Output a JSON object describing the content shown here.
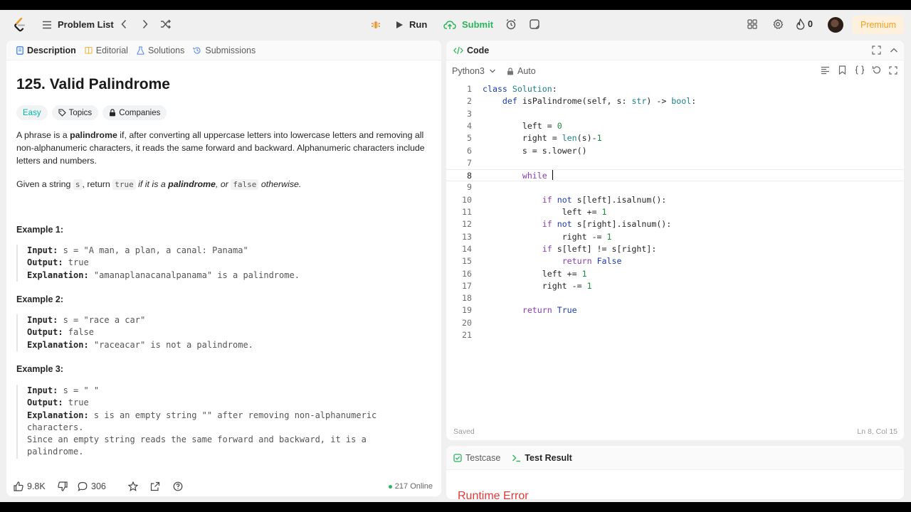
{
  "nav": {
    "problem_list": "Problem List",
    "run": "Run",
    "submit": "Submit",
    "streak": "0",
    "premium": "Premium"
  },
  "left": {
    "tabs": [
      {
        "label": "Description"
      },
      {
        "label": "Editorial"
      },
      {
        "label": "Solutions"
      },
      {
        "label": "Submissions"
      }
    ],
    "title": "125. Valid Palindrome",
    "badges": {
      "difficulty": "Easy",
      "topics": "Topics",
      "companies": "Companies"
    },
    "desc1": {
      "a": "A phrase is a ",
      "b": "palindrome",
      "c": " if, after converting all uppercase letters into lowercase letters and removing all non-alphanumeric characters, it reads the same forward and backward. Alphanumeric characters include letters and numbers."
    },
    "desc2": {
      "a": "Given a string ",
      "s": "s",
      "b": ", return ",
      "t": "true",
      "c": " if it is a ",
      "d": "palindrome",
      "e": ", or ",
      "f": "false",
      "g": " otherwise."
    },
    "examples": [
      {
        "title": "Example 1:",
        "input_label": "Input:",
        "input": " s = \"A man, a plan, a canal: Panama\"",
        "output_label": "Output:",
        "output": " true",
        "expl_label": "Explanation:",
        "expl": " \"amanaplanacanalpanama\" is a palindrome."
      },
      {
        "title": "Example 2:",
        "input_label": "Input:",
        "input": " s = \"race a car\"",
        "output_label": "Output:",
        "output": " false",
        "expl_label": "Explanation:",
        "expl": " \"raceacar\" is not a palindrome."
      },
      {
        "title": "Example 3:",
        "input_label": "Input:",
        "input": " s = \" \"",
        "output_label": "Output:",
        "output": " true",
        "expl_label": "Explanation:",
        "expl": " s is an empty string \"\" after removing non-alphanumeric characters.",
        "expl2": "Since an empty string reads the same forward and backward, it is a palindrome."
      }
    ],
    "footer": {
      "likes": "9.8K",
      "comments": "306",
      "online": "217 Online"
    }
  },
  "code": {
    "tab": "Code",
    "language": "Python3",
    "mode": "Auto",
    "saved": "Saved",
    "position": "Ln 8, Col 15",
    "lines": [
      "1",
      "2",
      "3",
      "4",
      "5",
      "6",
      "7",
      "8",
      "9",
      "10",
      "11",
      "12",
      "13",
      "14",
      "15",
      "16",
      "17",
      "18",
      "19",
      "20",
      "21"
    ],
    "code": {
      "class": "class",
      "Solution": "Solution",
      "colon": ":",
      "def": "def",
      "fn": "isPalindrome",
      "params": "(self, s: ",
      "str": "str",
      "arrow": ") -> ",
      "bool": "bool",
      "left0": "left = ",
      "zero": "0",
      "right_eq": "right = ",
      "len": "len",
      "len_args": "(s)-",
      "one": "1",
      "lower": "s = s.lower()",
      "while": "while",
      "if": "if",
      "not": "not",
      "isalnum_left": " s[left].isalnum():",
      "left_inc": "left += ",
      "isalnum_right": " s[right].isalnum():",
      "right_dec": "right -= ",
      "compare": " s[left] != s[right]:",
      "return": "return",
      "False": "False",
      "True": "True"
    }
  },
  "test": {
    "tabs": [
      {
        "label": "Testcase"
      },
      {
        "label": "Test Result"
      }
    ],
    "result": "Runtime Error"
  }
}
